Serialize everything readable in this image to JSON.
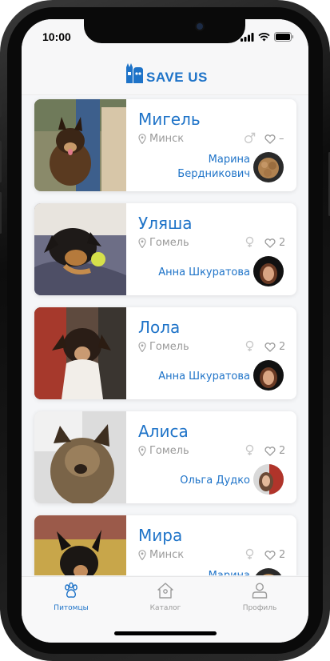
{
  "status_bar": {
    "time": "10:00"
  },
  "app": {
    "logo_text": "SAVE US",
    "accent": "#1e73c8"
  },
  "pets": [
    {
      "name": "Мигель",
      "city": "Минск",
      "gender": "male",
      "likes": "–",
      "owner": [
        "Марина",
        "Бердникович"
      ]
    },
    {
      "name": "Уляша",
      "city": "Гомель",
      "gender": "female",
      "likes": "2",
      "owner": [
        "Анна Шкуратова"
      ]
    },
    {
      "name": "Лола",
      "city": "Гомель",
      "gender": "female",
      "likes": "2",
      "owner": [
        "Анна Шкуратова"
      ]
    },
    {
      "name": "Алиса",
      "city": "Гомель",
      "gender": "female",
      "likes": "2",
      "owner": [
        "Ольга Дудко"
      ]
    },
    {
      "name": "Мира",
      "city": "Минск",
      "gender": "female",
      "likes": "2",
      "owner": [
        "Марина"
      ]
    }
  ],
  "tabbar": {
    "tabs": [
      {
        "label": "Питомцы",
        "icon": "paw-icon",
        "active": true
      },
      {
        "label": "Каталог",
        "icon": "home-icon",
        "active": false
      },
      {
        "label": "Профиль",
        "icon": "user-icon",
        "active": false
      }
    ]
  }
}
